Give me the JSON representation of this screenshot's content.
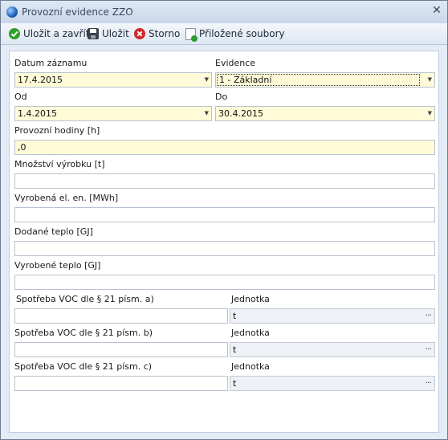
{
  "window": {
    "title": "Provozní evidence ZZO"
  },
  "toolbar": {
    "save_close": "Uložit a zavřít",
    "save": "Uložit",
    "cancel": "Storno",
    "attachments": "Přiložené soubory"
  },
  "form": {
    "datum_label": "Datum záznamu",
    "datum_value": "17.4.2015",
    "evidence_label": "Evidence",
    "evidence_value": "1 - Základní",
    "od_label": "Od",
    "od_value": "1.4.2015",
    "do_label": "Do",
    "do_value": "30.4.2015",
    "hodiny_label": "Provozní hodiny [h]",
    "hodiny_value": ",0",
    "vyrobek_label": "Množství výrobku [t]",
    "vyrobek_value": "",
    "el_label": "Vyrobená el. en. [MWh]",
    "el_value": "",
    "teplo_dodane_label": "Dodané teplo [GJ]",
    "teplo_dodane_value": "",
    "teplo_vyrobene_label": "Vyrobené teplo [GJ]",
    "teplo_vyrobene_value": "",
    "voc_a_label": "Spotřeba VOC dle § 21 písm. a)",
    "voc_a_value": "",
    "voc_b_label": "Spotřeba VOC dle § 21 písm. b)",
    "voc_b_value": "",
    "voc_c_label": "Spotřeba VOC dle § 21 písm. c)",
    "voc_c_value": "",
    "jednotka_label": "Jednotka",
    "jednotka_value": "t",
    "ellipsis": "···"
  },
  "colors": {
    "required_field": "#fffbd8",
    "window_bg": "#e3ebf5"
  }
}
